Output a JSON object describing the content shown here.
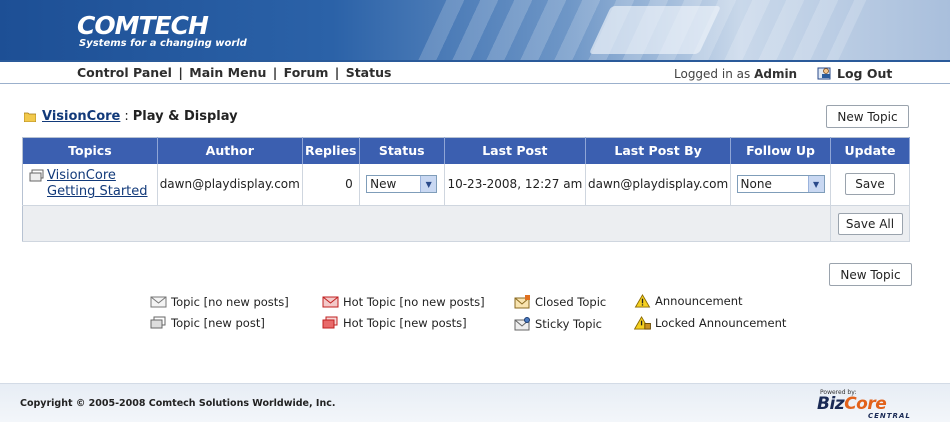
{
  "header": {
    "logo_text": "COMTECH",
    "tagline": "Systems for a changing world"
  },
  "nav": {
    "links": [
      "Control Panel",
      "Main Menu",
      "Forum",
      "Status"
    ],
    "separator": "|",
    "login_prefix": "Logged in as",
    "username": "Admin",
    "logout_label": "Log Out"
  },
  "breadcrumb": {
    "parent": "VisionCore",
    "separator": ":",
    "current": "Play & Display"
  },
  "buttons": {
    "new_topic": "New Topic",
    "save_all": "Save All",
    "save": "Save"
  },
  "table": {
    "headers": [
      "Topics",
      "Author",
      "Replies",
      "Status",
      "Last Post",
      "Last Post By",
      "Follow Up",
      "Update"
    ],
    "rows": [
      {
        "topic_line1": "VisionCore",
        "topic_line2": "Getting Started",
        "author": "dawn@playdisplay.com",
        "replies": "0",
        "status": "New",
        "last_post": "10-23-2008, 12:27 am",
        "last_post_by": "dawn@playdisplay.com",
        "follow_up": "None"
      }
    ]
  },
  "legend": {
    "topic_no_new": "Topic [no new posts]",
    "topic_new": "Topic [new post]",
    "hot_no_new": "Hot Topic [no new posts]",
    "hot_new": "Hot Topic [new posts]",
    "closed": "Closed Topic",
    "sticky": "Sticky Topic",
    "announcement": "Announcement",
    "locked_announcement": "Locked Announcement"
  },
  "footer": {
    "copyright": "Copyright © 2005-2008 Comtech Solutions Worldwide, Inc.",
    "powered_by": "Powered by:",
    "brand_biz": "Biz",
    "brand_core": "Core",
    "brand_central": "CENTRAL"
  },
  "colors": {
    "header_blue": "#3b5fb0",
    "link_blue": "#123a7a",
    "brand_orange": "#e2621b"
  }
}
